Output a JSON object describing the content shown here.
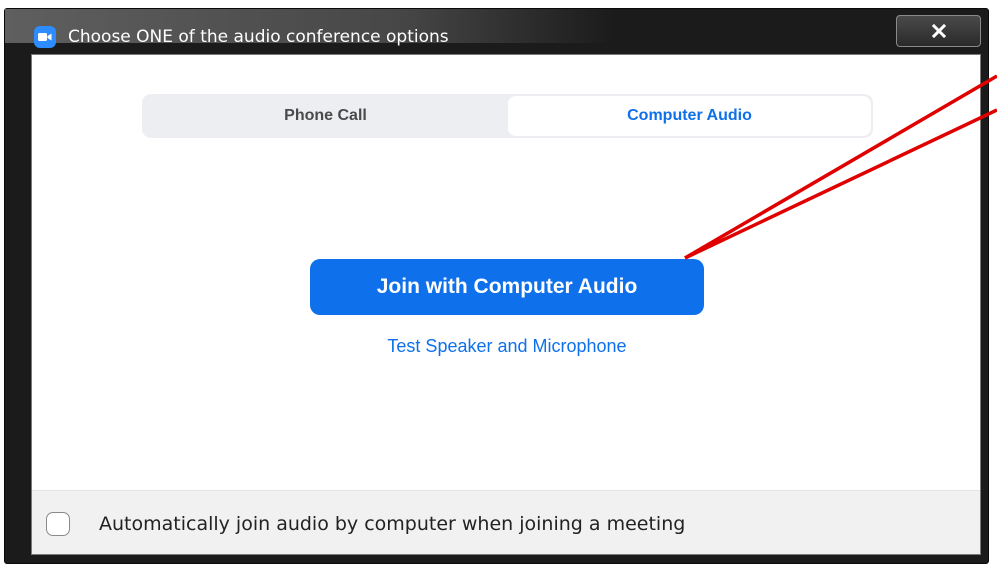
{
  "window": {
    "title": "Choose ONE of the audio conference options",
    "close_label": "X"
  },
  "tabs": [
    {
      "label": "Phone Call",
      "selected": false
    },
    {
      "label": "Computer Audio",
      "selected": true
    }
  ],
  "main": {
    "join_button_label": "Join with Computer Audio",
    "test_link_label": "Test Speaker and Microphone"
  },
  "footer": {
    "checkbox_label": "Automatically join audio by computer when joining a meeting",
    "checkbox_checked": false
  },
  "icons": {
    "app": "zoom-camera-icon",
    "close": "close-icon"
  },
  "colors": {
    "accent": "#0e71eb",
    "annotation": "#e00000"
  }
}
